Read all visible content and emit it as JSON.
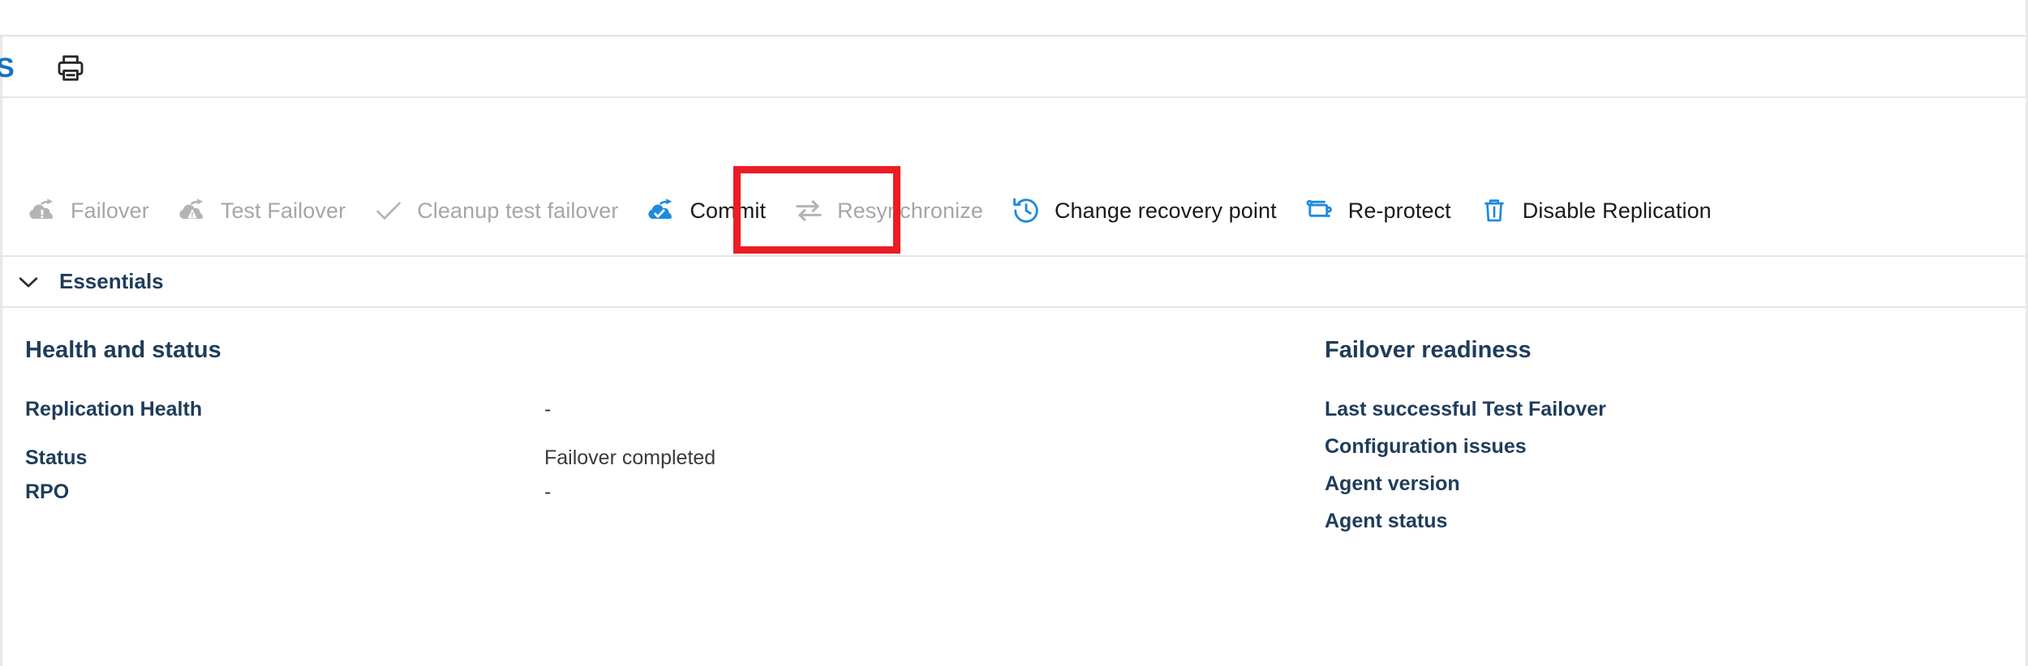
{
  "window": {
    "clipped_left_glyph": "S"
  },
  "command_bar": {
    "print_icon": "printer-icon"
  },
  "toolbar": {
    "items": [
      {
        "label": "Failover",
        "icon": "cloud-failover-icon",
        "enabled": false
      },
      {
        "label": "Test Failover",
        "icon": "cloud-test-failover-icon",
        "enabled": false
      },
      {
        "label": "Cleanup test failover",
        "icon": "checkmark-icon",
        "enabled": false
      },
      {
        "label": "Commit",
        "icon": "cloud-commit-icon",
        "enabled": true
      },
      {
        "label": "Resynchronize",
        "icon": "two-way-arrows-icon",
        "enabled": false
      },
      {
        "label": "Change recovery point",
        "icon": "clock-rewind-icon",
        "enabled": true
      },
      {
        "label": "Re-protect",
        "icon": "re-protect-icon",
        "enabled": true
      },
      {
        "label": "Disable Replication",
        "icon": "trash-icon",
        "enabled": true
      }
    ],
    "highlight": {
      "target_label": "Commit",
      "color": "#ec1c24"
    }
  },
  "essentials": {
    "label": "Essentials",
    "expanded": true,
    "chevron_icon": "chevron-down-icon"
  },
  "health_and_status": {
    "title": "Health and status",
    "rows": [
      {
        "key": "Replication Health",
        "value": "-"
      },
      {
        "key": "Status",
        "value": "Failover completed"
      },
      {
        "key": "RPO",
        "value": "-"
      }
    ]
  },
  "failover_readiness": {
    "title": "Failover readiness",
    "rows": [
      {
        "key": "Last successful Test Failover",
        "value": ""
      },
      {
        "key": "Configuration issues",
        "value": ""
      },
      {
        "key": "Agent version",
        "value": ""
      },
      {
        "key": "Agent status",
        "value": ""
      }
    ]
  },
  "colors": {
    "accent_blue": "#0f86e0",
    "heading_blue": "#1f3c5a",
    "highlight_red": "#ec1c24",
    "disabled_gray": "#a6a6a6",
    "divider": "#e6e6e6"
  }
}
